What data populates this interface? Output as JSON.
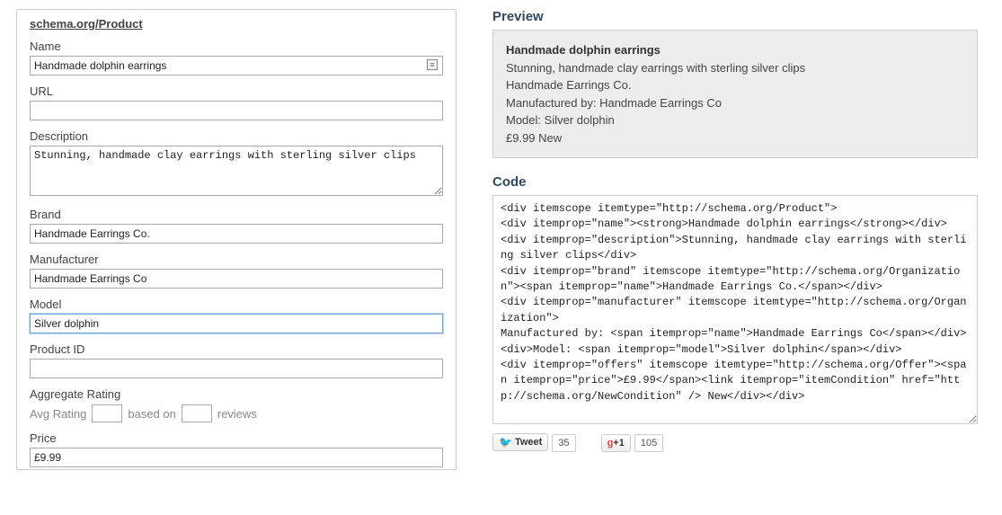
{
  "schema_title": "schema.org/Product",
  "fields": {
    "name": {
      "label": "Name",
      "value": "Handmade dolphin earrings"
    },
    "url": {
      "label": "URL",
      "value": ""
    },
    "description": {
      "label": "Description",
      "value": "Stunning, handmade clay earrings with sterling silver clips"
    },
    "brand": {
      "label": "Brand",
      "value": "Handmade Earrings Co."
    },
    "manufacturer": {
      "label": "Manufacturer",
      "value": "Handmade Earrings Co"
    },
    "model": {
      "label": "Model",
      "value": "Silver dolphin"
    },
    "product_id": {
      "label": "Product ID",
      "value": ""
    },
    "aggregate": {
      "label": "Aggregate Rating",
      "avg_text": "Avg Rating",
      "based_on_text": "based on",
      "reviews_text": "reviews",
      "avg_value": "",
      "reviews_value": ""
    },
    "price": {
      "label": "Price",
      "value": "£9.99"
    }
  },
  "preview": {
    "heading": "Preview",
    "title": "Handmade dolphin earrings",
    "description": "Stunning, handmade clay earrings with sterling silver clips",
    "brand": "Handmade Earrings Co.",
    "manufactured_by_label": "Manufactured by:",
    "manufacturer": "Handmade Earrings Co",
    "model_label": "Model:",
    "model": "Silver dolphin",
    "price_line": "£9.99 New"
  },
  "code": {
    "heading": "Code",
    "text": "<div itemscope itemtype=\"http://schema.org/Product\">\n<div itemprop=\"name\"><strong>Handmade dolphin earrings</strong></div>\n<div itemprop=\"description\">Stunning, handmade clay earrings with sterling silver clips</div>\n<div itemprop=\"brand\" itemscope itemtype=\"http://schema.org/Organization\"><span itemprop=\"name\">Handmade Earrings Co.</span></div>\n<div itemprop=\"manufacturer\" itemscope itemtype=\"http://schema.org/Organization\">\nManufactured by: <span itemprop=\"name\">Handmade Earrings Co</span></div>\n<div>Model: <span itemprop=\"model\">Silver dolphin</span></div>\n<div itemprop=\"offers\" itemscope itemtype=\"http://schema.org/Offer\"><span itemprop=\"price\">£9.99</span><link itemprop=\"itemCondition\" href=\"http://schema.org/NewCondition\" /> New</div></div>"
  },
  "social": {
    "tweet_label": "Tweet",
    "tweet_count": "35",
    "gplus_label": "+1",
    "gplus_count": "105"
  }
}
